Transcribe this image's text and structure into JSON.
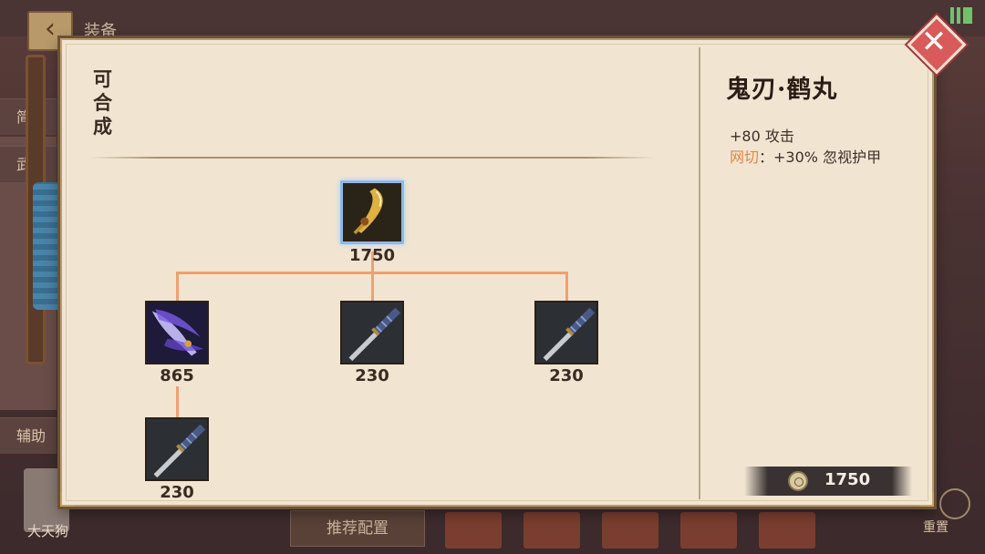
{
  "background": {
    "title": "装备",
    "left_tabs": [
      "简易",
      "武器",
      "辅助"
    ],
    "avatar_name": "大天狗",
    "recommend_label": "推荐配置",
    "reset_label": "重置"
  },
  "panel": {
    "heading": "可合成",
    "tree": {
      "root": {
        "icon": "golden-blade-icon",
        "price": "1750"
      },
      "children": [
        {
          "icon": "purple-flame-blade-icon",
          "price": "865"
        },
        {
          "icon": "katana-icon",
          "price": "230"
        },
        {
          "icon": "katana-icon",
          "price": "230"
        }
      ],
      "grandchild": {
        "icon": "katana-icon",
        "price": "230"
      }
    },
    "details": {
      "name": "鬼刃·鹤丸",
      "stat": "+80 攻击",
      "passive_name": "网切",
      "passive_text": "：+30% 忽视护甲",
      "total_price": "1750"
    },
    "close_icon": "close-icon"
  },
  "colors": {
    "panel_bg": "#f1e5d2",
    "tree_line": "#f0a070",
    "passive_name": "#e8843a",
    "close_button": "#d85a5a"
  }
}
